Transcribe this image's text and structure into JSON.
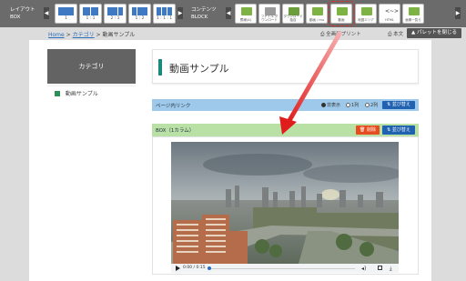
{
  "toolbar": {
    "layout_label_line1": "レイアウト",
    "layout_label_line2": "BOX",
    "content_label_line1": "コンテンツ",
    "content_label_line2": "BLOCK",
    "layouts": [
      {
        "label": "1",
        "cols": 1
      },
      {
        "label": "1 : 1",
        "cols": 2
      },
      {
        "label": "2 : 1",
        "cols": 2
      },
      {
        "label": "1 : 2",
        "cols": 2
      },
      {
        "label": "1 : 1 : 1",
        "cols": 3
      }
    ],
    "blocks": [
      {
        "label": "罫線(A)"
      },
      {
        "label": "ファイル ダウンロード"
      },
      {
        "label": "ダウンロード 独自"
      },
      {
        "label": "動画 / mu"
      },
      {
        "label": "動画"
      },
      {
        "label": "地図エリア"
      },
      {
        "label": "HTML"
      },
      {
        "label": "画像一覧ら"
      }
    ]
  },
  "breadcrumb": {
    "home": "Home",
    "sep": ">",
    "category": "カテゴリ",
    "current": "動画サンプル"
  },
  "header_links": {
    "print": "全画面プリント",
    "text": "本文"
  },
  "palette_button": "パレットを閉じる",
  "sidebar": {
    "heading": "カテゴリ",
    "item": "動画サンプル"
  },
  "page_title": "動画サンプル",
  "anchor_bar": {
    "title": "ページ内リンク",
    "options": [
      "非表示",
      "1列",
      "2列"
    ],
    "selected": 0,
    "sort_label": "並び替え"
  },
  "box_bar": {
    "title": "BOX（1カラム）",
    "delete_label": "削除",
    "sort_label": "並び替え"
  },
  "video": {
    "time": "0:00 / 0:15",
    "progress": 0.0
  }
}
